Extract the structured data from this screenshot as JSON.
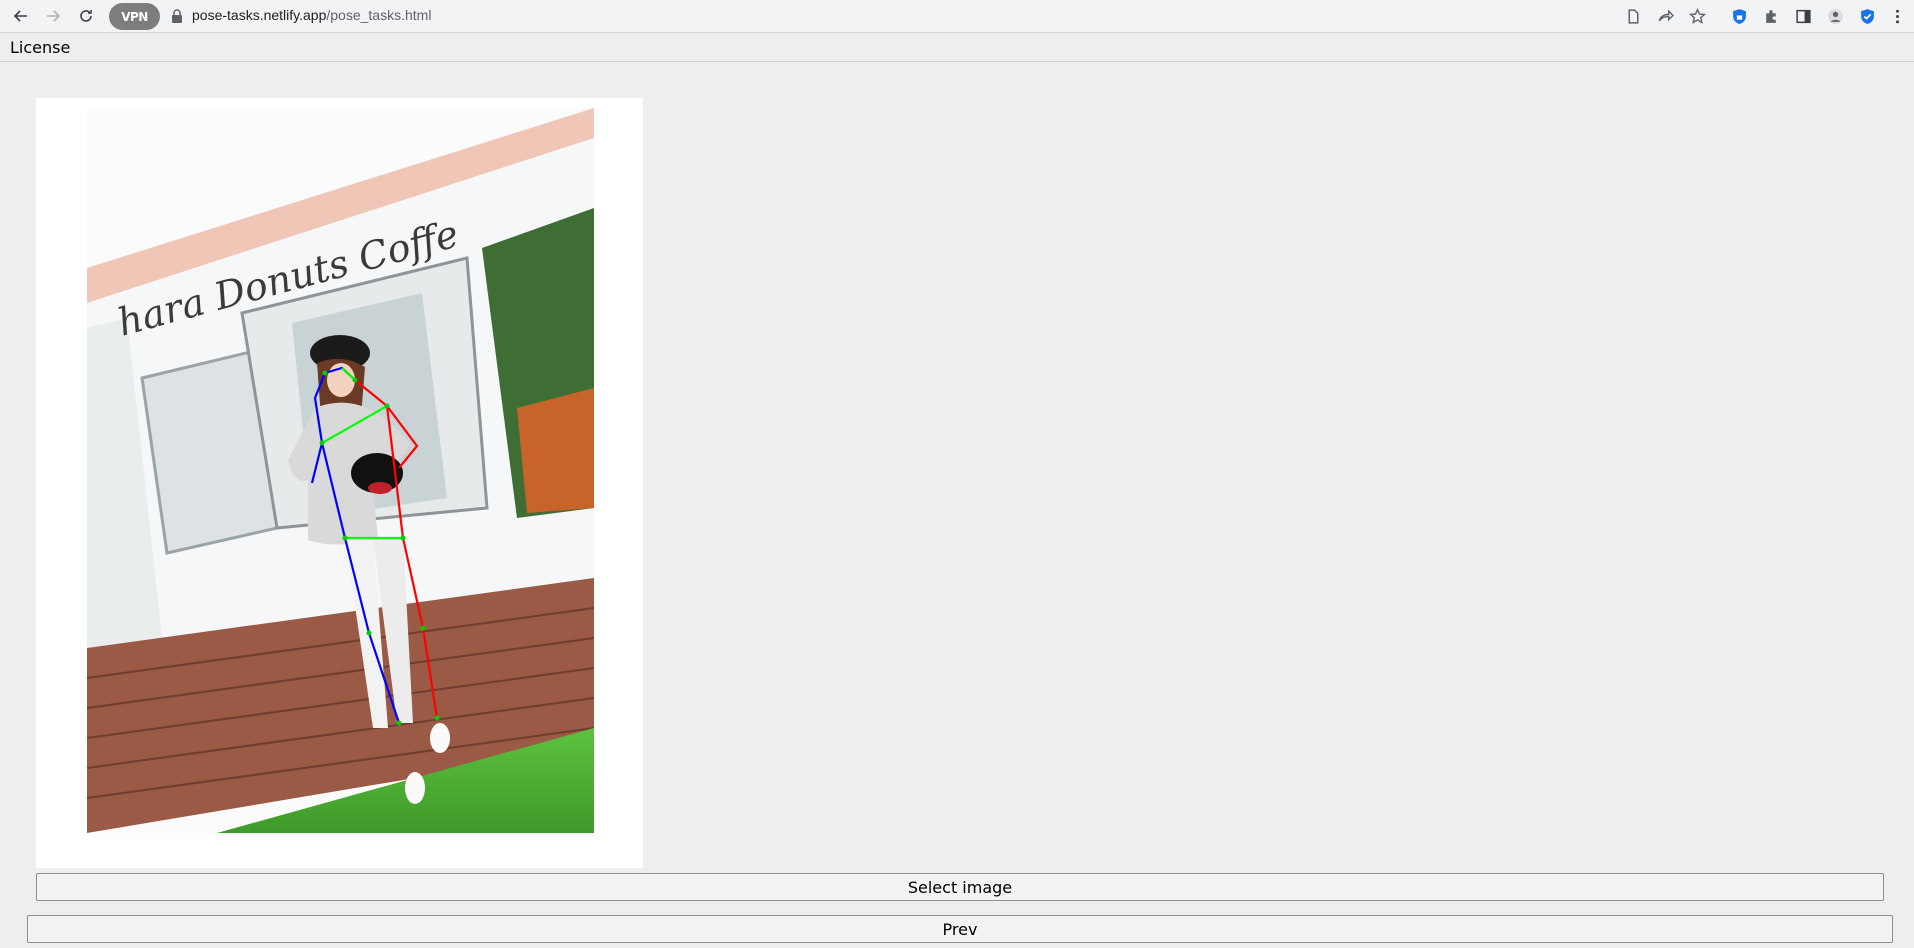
{
  "browser": {
    "vpn_label": "VPN",
    "url_host": "pose-tasks.netlify.app",
    "url_path": "/pose_tasks.html"
  },
  "page": {
    "license_link": "License",
    "photo_sign_text": "hara Donuts Coffe",
    "select_button": "Select image",
    "prev_button": "Prev"
  },
  "colors": {
    "page_bg": "#eeeeee",
    "left_limb": "#0000ff",
    "right_limb": "#ff0000",
    "torso_link": "#00ff00"
  },
  "icons": [
    "back-icon",
    "forward-icon",
    "reload-icon",
    "lock-icon",
    "document-icon",
    "share-icon",
    "star-icon",
    "shield-icon",
    "puzzle-icon",
    "sidebar-icon",
    "profile-icon",
    "check-shield-icon",
    "more-icon"
  ]
}
